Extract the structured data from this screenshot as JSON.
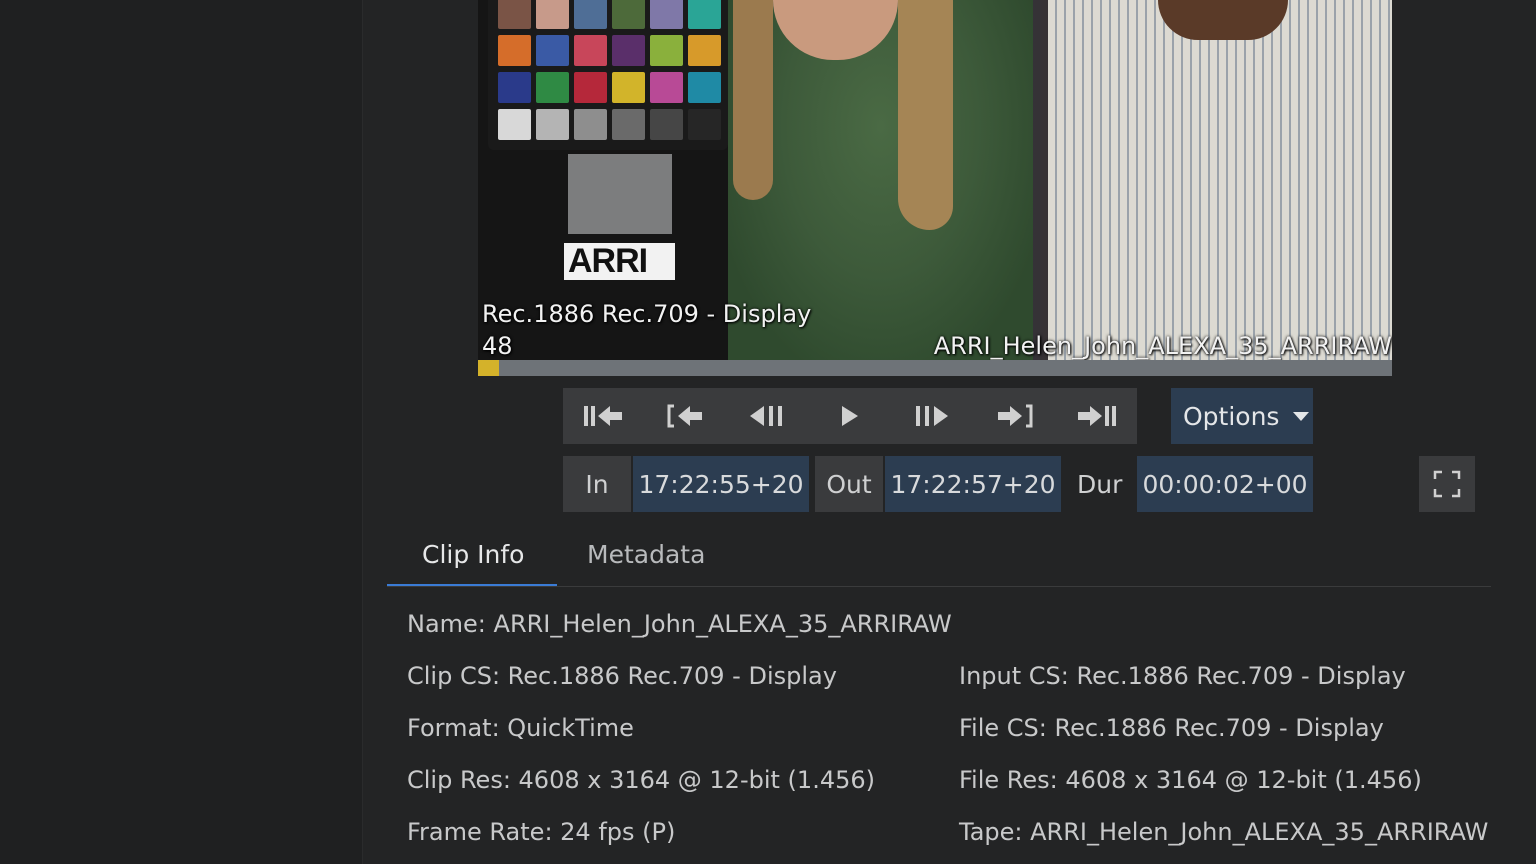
{
  "viewer": {
    "colorspace_overlay": "Rec.1886 Rec.709 - Display",
    "frame_overlay": "48",
    "clip_overlay": "ARRI_Helen_John_ALEXA_35_ARRIRAW",
    "logo_text": "ARRI",
    "playhead_fraction": 0.023
  },
  "transport": {
    "buttons": [
      {
        "name": "go-to-start",
        "glyph": "II◀"
      },
      {
        "name": "go-to-in",
        "glyph": "[◀"
      },
      {
        "name": "step-back",
        "glyph": "◀II"
      },
      {
        "name": "play",
        "glyph": "▶"
      },
      {
        "name": "step-forward",
        "glyph": "II▶"
      },
      {
        "name": "go-to-out",
        "glyph": "▶]"
      },
      {
        "name": "go-to-end",
        "glyph": "▶II"
      }
    ],
    "options_label": "Options"
  },
  "timecode": {
    "in_label": "In",
    "in_value": "17:22:55+20",
    "out_label": "Out",
    "out_value": "17:22:57+20",
    "dur_label": "Dur",
    "dur_value": "00:00:02+00"
  },
  "tabs": {
    "clip_info": "Clip Info",
    "metadata": "Metadata"
  },
  "clip_info": {
    "name": "Name: ARRI_Helen_John_ALEXA_35_ARRIRAW",
    "clip_cs": "Clip CS: Rec.1886 Rec.709 - Display",
    "input_cs": "Input CS: Rec.1886 Rec.709 - Display",
    "format": "Format: QuickTime",
    "file_cs": "File CS: Rec.1886 Rec.709 - Display",
    "clip_res": "Clip Res: 4608 x 3164 @ 12-bit (1.456)",
    "file_res": "File Res: 4608 x 3164 @ 12-bit (1.456)",
    "frame_rate": "Frame Rate: 24 fps (P)",
    "tape": "Tape: ARRI_Helen_John_ALEXA_35_ARRIRAW"
  },
  "colors": {
    "accent_blue": "#3a7bd5",
    "timecode_bg": "#2c3d51",
    "button_bg": "#3a3b3d",
    "playhead": "#d4b22a"
  }
}
